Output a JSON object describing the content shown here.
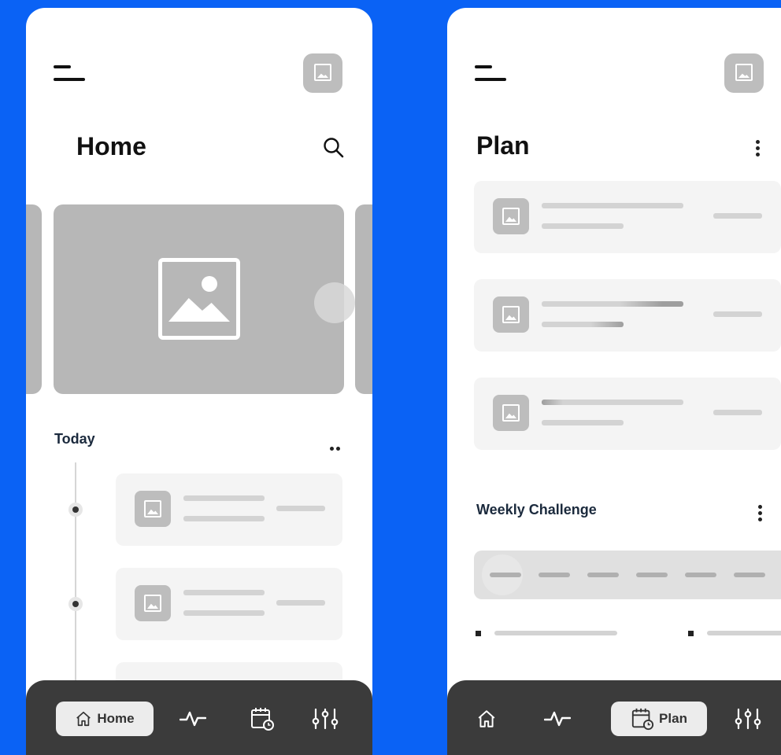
{
  "home_screen": {
    "title": "Home",
    "section_today": "Today",
    "tabs": [
      {
        "label": "Home",
        "icon": "home-icon",
        "active": true
      },
      {
        "label": "",
        "icon": "activity-icon",
        "active": false
      },
      {
        "label": "",
        "icon": "calendar-icon",
        "active": false
      },
      {
        "label": "",
        "icon": "sliders-icon",
        "active": false
      }
    ]
  },
  "plan_screen": {
    "title": "Plan",
    "section_challenge": "Weekly Challenge",
    "tabs": [
      {
        "label": "",
        "icon": "home-icon",
        "active": false
      },
      {
        "label": "",
        "icon": "activity-icon",
        "active": false
      },
      {
        "label": "Plan",
        "icon": "calendar-icon",
        "active": true
      },
      {
        "label": "",
        "icon": "sliders-icon",
        "active": false
      }
    ]
  },
  "colors": {
    "background": "#0a62f5",
    "tabbar": "#3b3b3b",
    "placeholder": "#b7b7b7",
    "card": "#f4f4f4"
  }
}
